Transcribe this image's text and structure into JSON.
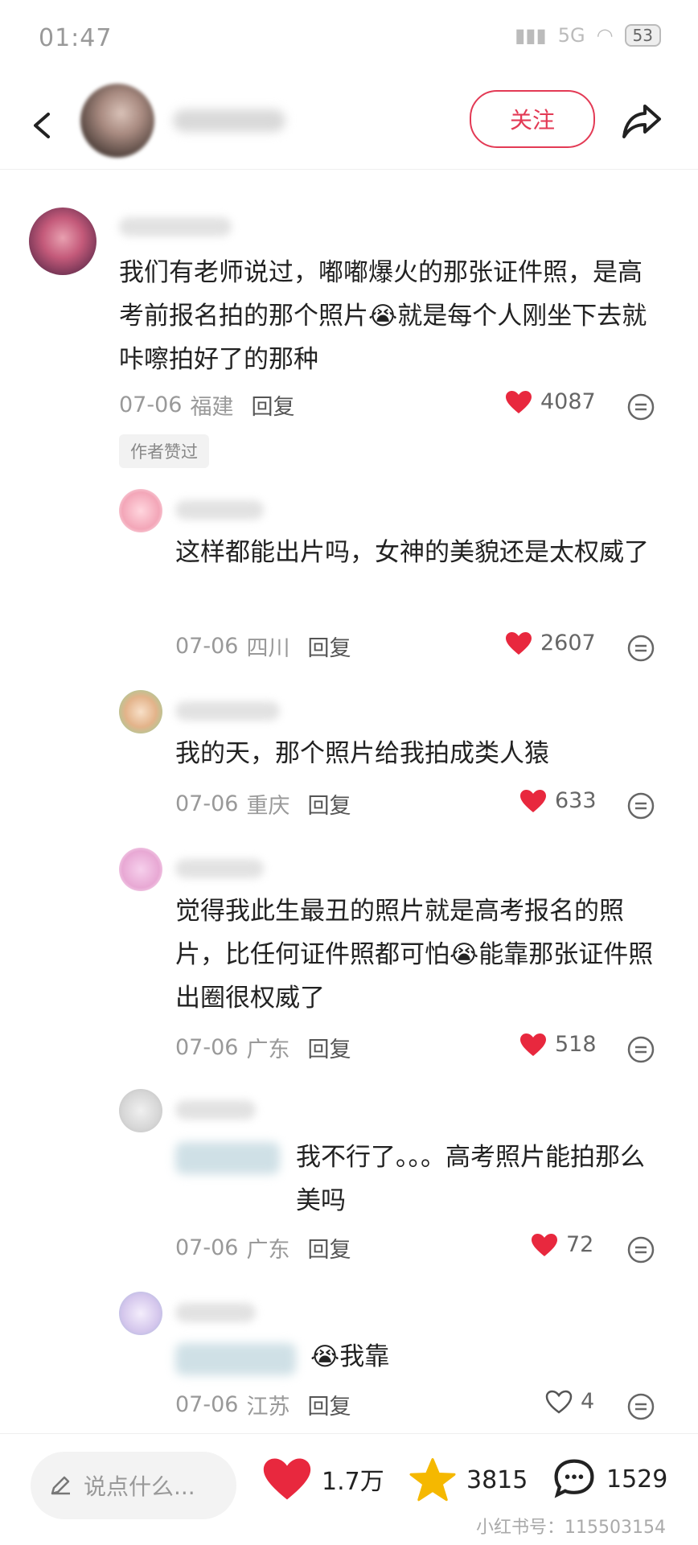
{
  "status_bar": {
    "time": "01:47",
    "signal_text": "5G",
    "battery": "53"
  },
  "header": {
    "follow_label": "关注"
  },
  "comments": [
    {
      "text": "我们有老师说过，嘟嘟爆火的那张证件照，是高考前报名拍的那个照片😭就是每个人刚坐下去就咔嚓拍好了的那种",
      "date": "07-06",
      "location": "福建",
      "reply": "回复",
      "likes": "4087",
      "liked": true,
      "tag": "作者赞过"
    },
    {
      "text": "这样都能出片吗，女神的美貌还是太权威了",
      "date": "07-06",
      "location": "四川",
      "reply": "回复",
      "likes": "2607",
      "liked": true
    },
    {
      "text": "我的天，那个照片给我拍成类人猿",
      "date": "07-06",
      "location": "重庆",
      "reply": "回复",
      "likes": "633",
      "liked": true
    },
    {
      "text": "觉得我此生最丑的照片就是高考报名的照片，比任何证件照都可怕😭能靠那张证件照出圈很权威了",
      "date": "07-06",
      "location": "广东",
      "reply": "回复",
      "likes": "518",
      "liked": true
    },
    {
      "text": "我不行了。。。高考照片能拍那么美吗",
      "date": "07-06",
      "location": "广东",
      "reply": "回复",
      "likes": "72",
      "liked": true
    },
    {
      "text": "😭我靠",
      "date": "07-06",
      "location": "江苏",
      "reply": "回复",
      "likes": "4",
      "liked": false
    }
  ],
  "bottom_bar": {
    "input_placeholder": "说点什么...",
    "likes": "1.7万",
    "stars": "3815",
    "comments": "1529",
    "watermark": "小红书号：115503154"
  },
  "colors": {
    "accent": "#e33a55",
    "heart": "#e8283e",
    "star": "#f5b800"
  }
}
